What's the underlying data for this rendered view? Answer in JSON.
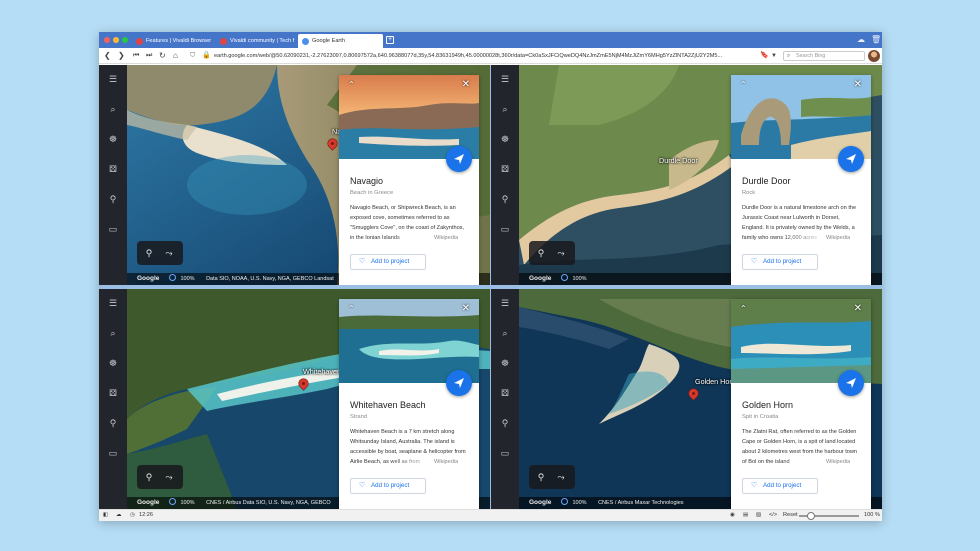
{
  "browser": {
    "tabs": [
      {
        "label": "Features | Vivaldi Browser",
        "active": false
      },
      {
        "label": "Vivaldi community | Tech f",
        "active": false
      },
      {
        "label": "Google Earth",
        "active": true
      }
    ],
    "url": "earth.google.com/web/@50.62090231,-2.27623097,0.80697572a,640.96388077d,35y,54.83631949h,45.00000028t,360r/data=Ck0aSxJFCiQweDQ4NzJmZmE5NjM4MzJiZmY6MHg5YzZlNTA2ZjU2Y2M5...",
    "search_placeholder": "Search Bing"
  },
  "rail_icons": [
    "menu-icon",
    "search-icon",
    "voyager-icon",
    "dice-icon",
    "pin-icon",
    "ruler-icon"
  ],
  "map_footer": {
    "logo": "Google",
    "zoom": "100%"
  },
  "panes": [
    {
      "place_label": "Navagio",
      "attribution": "Data SIO, NOAA, U.S. Navy, NGA, GEBCO  Landsat",
      "card": {
        "title": "Navagio",
        "subtitle": "Beach in Greece",
        "description": "Navagio Beach, or Shipwreck Beach, is an exposed cove, sometimes referred to as \"Smugglers Cove\", on the coast of Zakynthos, in the Ionian Islands",
        "source": "Wikipedia",
        "action": "Add to project"
      }
    },
    {
      "place_label": "Durdle Door",
      "attribution": "",
      "card": {
        "title": "Durdle Door",
        "subtitle": "Rock",
        "description": "Durdle Door is a natural limestone arch on the Jurassic Coast near Lulworth in Dorset, England. It is privately owned by the Welds, a family who owns 12,000 acres",
        "source": "Wikipedia",
        "action": "Add to project"
      }
    },
    {
      "place_label": "Whitehaven Beach",
      "attribution": "CNES / Airbus  Data SIO, U.S. Navy, NGA, GEBCO",
      "card": {
        "title": "Whitehaven Beach",
        "subtitle": "Strand",
        "description": "Whitehaven Beach is a 7 km stretch along Whitsunday Island, Australia. The island is accessible by boat, seaplane & helicopter from Airlie Beach, as well as from",
        "source": "Wikipedia",
        "action": "Add to project"
      }
    },
    {
      "place_label": "Golden Horn",
      "attribution": "CNES / Airbus  Maxar Technologies",
      "card": {
        "title": "Golden Horn",
        "subtitle": "Spit in Croatia",
        "description": "The Zlatni Rat, often referred to as the Golden Cape or Golden Horn, is a spit of land located about 2 kilometres west from the harbour town of Bol on the island",
        "source": "Wikipedia",
        "action": "Add to project"
      }
    }
  ],
  "status_bar": {
    "time": "12:26",
    "reset": "Reset",
    "zoom": "100 %"
  },
  "colors": {
    "tabbar": "#4575c8",
    "accent": "#1a73e8",
    "rail": "#22252b"
  }
}
